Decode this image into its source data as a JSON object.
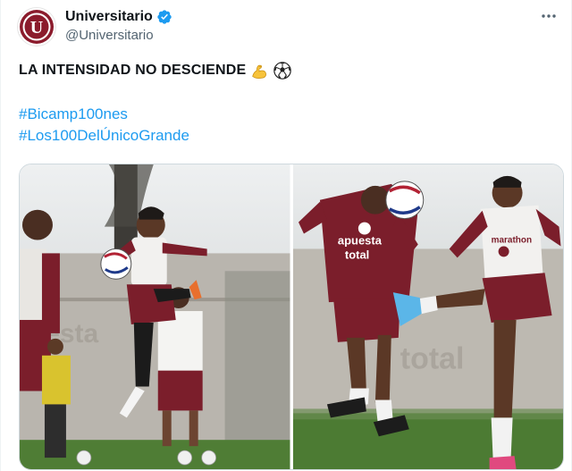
{
  "author": {
    "display_name": "Universitario",
    "handle": "@Universitario",
    "avatar_letter": "U",
    "verified": true,
    "brand_color": "#8b1b2c"
  },
  "tweet": {
    "headline": "LA INTENSIDAD NO DESCIENDE",
    "emojis": [
      "flexed-biceps-icon",
      "soccer-ball-icon"
    ],
    "hashtags": [
      "#Bicamp100nes",
      "#Los100DelÚnicoGrande"
    ]
  },
  "media": {
    "count": 2,
    "photos": [
      {
        "id": "photo-1",
        "sponsor_text": ""
      },
      {
        "id": "photo-2",
        "sponsor_text_1": "apuesta",
        "sponsor_text_2": "total",
        "sleeve_text": "marathon",
        "wall_text": "total"
      }
    ]
  },
  "colors": {
    "link": "#1d9bf0",
    "secondary_text": "#536471",
    "verified": "#1d9bf0",
    "kit_maroon": "#7b1e2b"
  }
}
